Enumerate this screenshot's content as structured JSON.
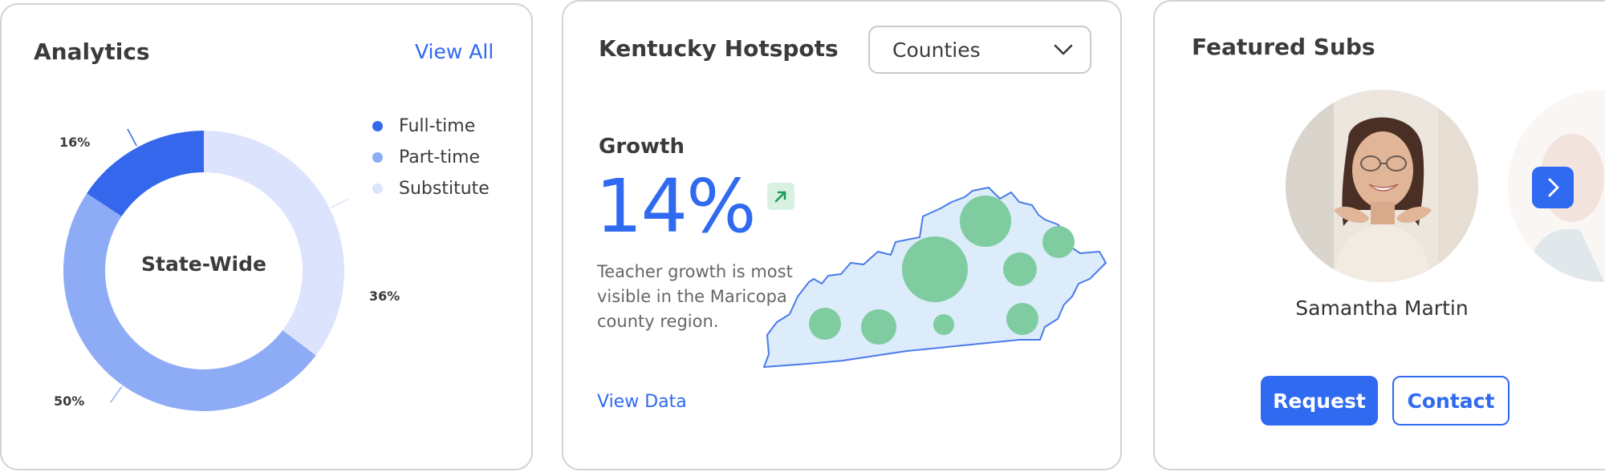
{
  "analytics": {
    "title": "Analytics",
    "view_all": "View All",
    "center_label": "State-Wide",
    "legend": [
      {
        "label": "Full-time",
        "color": "#3567ec"
      },
      {
        "label": "Part-time",
        "color": "#8eabf6"
      },
      {
        "label": "Substitute",
        "color": "#dbe4fc"
      }
    ],
    "chart_data": {
      "type": "pie",
      "categories": [
        "Full-time",
        "Part-time",
        "Substitute"
      ],
      "values": [
        16,
        50,
        36
      ],
      "value_labels": [
        "16%",
        "50%",
        "36%"
      ],
      "legend_position": "top-right",
      "center_text": "State-Wide"
    }
  },
  "hotspots": {
    "title": "Kentucky Hotspots",
    "dropdown_value": "Counties",
    "growth_label": "Growth",
    "growth_value": "14%",
    "trend_icon": "arrow-up-right-icon",
    "description": "Teacher growth is most visible in the Maricopa county region.",
    "view_data": "View Data",
    "map_fill": "#dcecfa",
    "map_stroke": "#4a7bea",
    "bubble_color": "#7fcca0"
  },
  "subs": {
    "title": "Featured Subs",
    "name": "Samantha Martin",
    "request_label": "Request",
    "contact_label": "Contact",
    "next_icon": "chevron-right-icon"
  }
}
